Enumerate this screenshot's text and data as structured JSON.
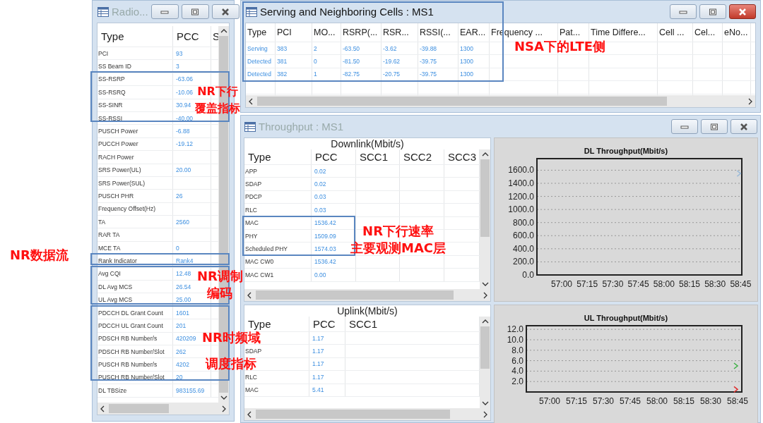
{
  "radio_window": {
    "title": "Radio...",
    "active": false,
    "columns": [
      "Type",
      "PCC",
      "S"
    ],
    "rows": [
      {
        "type": "PCI",
        "pcc": "93"
      },
      {
        "type": "SS Beam ID",
        "pcc": "3"
      },
      {
        "type": "SS-RSRP",
        "pcc": "-63.06"
      },
      {
        "type": "SS-RSRQ",
        "pcc": "-10.06"
      },
      {
        "type": "SS-SINR",
        "pcc": "30.94"
      },
      {
        "type": "SS-RSSI",
        "pcc": "-40.00"
      },
      {
        "type": "PUSCH Power",
        "pcc": "-6.88"
      },
      {
        "type": "PUCCH Power",
        "pcc": "-19.12"
      },
      {
        "type": "RACH Power"
      },
      {
        "type": "SRS Power(UL)",
        "pcc": "20.00"
      },
      {
        "type": "SRS Power(SUL)"
      },
      {
        "type": "PUSCH PHR",
        "pcc": "26"
      },
      {
        "type": "Frequency Offset(Hz)"
      },
      {
        "type": "TA",
        "pcc": "2560"
      },
      {
        "type": "RAR TA"
      },
      {
        "type": "MCE TA",
        "pcc": "0"
      },
      {
        "type": "Rank Indicator",
        "pcc": "Rank4"
      },
      {
        "type": "Avg CQI",
        "pcc": "12.48"
      },
      {
        "type": "DL Avg MCS",
        "pcc": "26.54"
      },
      {
        "type": "UL Avg MCS",
        "pcc": "25.00"
      },
      {
        "type": "PDCCH DL Grant Count",
        "pcc": "1601"
      },
      {
        "type": "PDCCH UL Grant Count",
        "pcc": "201"
      },
      {
        "type": "PDSCH RB Number/s",
        "pcc": "420209"
      },
      {
        "type": "PDSCH RB Number/Slot",
        "pcc": "262"
      },
      {
        "type": "PUSCH RB Number/s",
        "pcc": "4202"
      },
      {
        "type": "PUSCH RB Number/Slot",
        "pcc": "20"
      },
      {
        "type": "DL TBSize",
        "pcc": "983155.69"
      }
    ]
  },
  "cells_window": {
    "title": "Serving and Neighboring Cells : MS1",
    "active": true,
    "columns": [
      "Type",
      "PCI",
      "MO...",
      "RSRP(...",
      "RSR...",
      "RSSI(...",
      "EAR...",
      "Frequency ...",
      "Pat...",
      "Time Differe...",
      "Cell ...",
      "Cel...",
      "eNo..."
    ],
    "rows": [
      {
        "cells": [
          "Serving",
          "383",
          "2",
          "-63.50",
          "-3.62",
          "-39.88",
          "1300"
        ]
      },
      {
        "cells": [
          "Detected",
          "381",
          "0",
          "-81.50",
          "-19.62",
          "-39.75",
          "1300"
        ]
      },
      {
        "cells": [
          "Detected",
          "382",
          "1",
          "-82.75",
          "-20.75",
          "-39.75",
          "1300"
        ]
      }
    ]
  },
  "throughput_window": {
    "title": "Throughput : MS1",
    "active": false,
    "downlink": {
      "caption": "Downlink(Mbit/s)",
      "columns": [
        "Type",
        "PCC",
        "SCC1",
        "SCC2",
        "SCC3"
      ],
      "rows": [
        {
          "type": "APP",
          "pcc": "0.02"
        },
        {
          "type": "SDAP",
          "pcc": "0.02"
        },
        {
          "type": "PDCP",
          "pcc": "0.03"
        },
        {
          "type": "RLC",
          "pcc": "0.03"
        },
        {
          "type": "MAC",
          "pcc": "1536.42"
        },
        {
          "type": "PHY",
          "pcc": "1509.09"
        },
        {
          "type": "Scheduled PHY",
          "pcc": "1574.03"
        },
        {
          "type": "MAC CW0",
          "pcc": "1536.42"
        },
        {
          "type": "MAC CW1",
          "pcc": "0.00"
        }
      ]
    },
    "uplink": {
      "caption": "Uplink(Mbit/s)",
      "columns": [
        "Type",
        "PCC",
        "SCC1"
      ],
      "rows": [
        {
          "pcc": "1.17"
        },
        {
          "type": "SDAP",
          "pcc": "1.17"
        },
        {
          "pcc": "1.17"
        },
        {
          "type": "RLC",
          "pcc": "1.17"
        },
        {
          "type": "MAC",
          "pcc": "5.41"
        }
      ]
    },
    "dl_chart": {
      "chart_data": {
        "type": "line",
        "title": "DL Throughput(Mbit/s)",
        "grid": true,
        "categories": [
          "57:00",
          "57:15",
          "57:30",
          "57:45",
          "58:00",
          "58:15",
          "58:30",
          "58:45"
        ],
        "ylim": [
          0,
          1777
        ],
        "yticks": [
          {
            "value": 0,
            "label": "0.0"
          },
          {
            "value": 200,
            "label": "200.0"
          },
          {
            "value": 400,
            "label": "400.0"
          },
          {
            "value": 600,
            "label": "600.0"
          },
          {
            "value": 800,
            "label": "800.0"
          },
          {
            "value": 1000,
            "label": "1000.0"
          },
          {
            "value": 1200,
            "label": "1200.0"
          },
          {
            "value": 1400,
            "label": "1400.0"
          },
          {
            "value": 1600,
            "label": "1600.0"
          }
        ],
        "series": [
          {
            "color": "#9bbbd9",
            "marker": true,
            "values": [
              null,
              null,
              null,
              null,
              null,
              null,
              null,
              1550
            ]
          }
        ]
      }
    },
    "ul_chart": {
      "chart_data": {
        "type": "line",
        "title": "UL Throughput(Mbit/s)",
        "grid": true,
        "categories": [
          "57:00",
          "57:15",
          "57:30",
          "57:45",
          "58:00",
          "58:15",
          "58:30",
          "58:45"
        ],
        "ylim": [
          0,
          12.7
        ],
        "yticks": [
          {
            "value": 2,
            "label": "2.0"
          },
          {
            "value": 4,
            "label": "4.0"
          },
          {
            "value": 6,
            "label": "6.0"
          },
          {
            "value": 8,
            "label": "8.0"
          },
          {
            "value": 10,
            "label": "10.0"
          },
          {
            "value": 12,
            "label": "12.0"
          }
        ],
        "series": [
          {
            "color": "#3cb043",
            "marker": true,
            "values": [
              null,
              null,
              null,
              null,
              null,
              null,
              null,
              5
            ]
          },
          {
            "color": "#e03030",
            "marker": true,
            "values": [
              null,
              null,
              null,
              null,
              null,
              null,
              null,
              0.5
            ]
          }
        ]
      }
    }
  },
  "annotations": [
    {
      "lines": [
        "NR下行",
        "覆盖指标"
      ]
    },
    {
      "lines": [
        "NSA下的LTE侧"
      ]
    },
    {
      "lines": [
        "NR数据流"
      ]
    },
    {
      "lines": [
        "NR调制",
        "编码"
      ]
    },
    {
      "lines": [
        "NR时频域",
        "调度指标"
      ]
    },
    {
      "lines": [
        "NR下行速率",
        "主要观测MAC层"
      ]
    }
  ]
}
